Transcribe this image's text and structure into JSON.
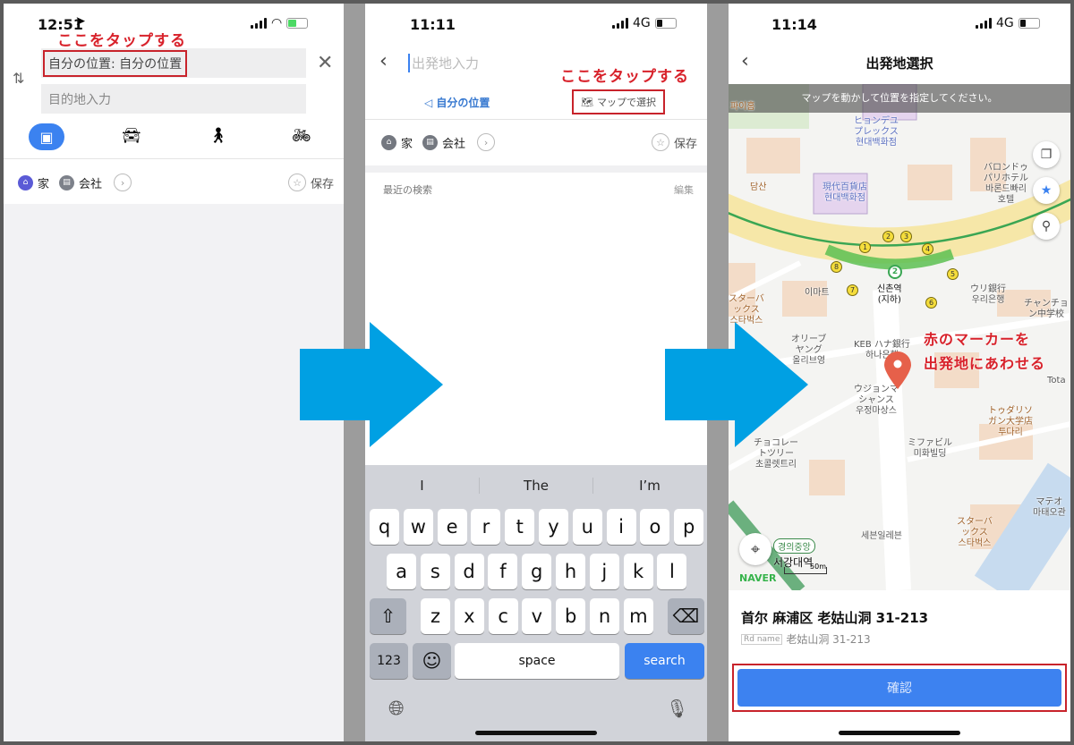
{
  "colors": {
    "accent": "#3b82f0",
    "annotation": "#d8222b",
    "arrow": "#00a0e3"
  },
  "panel1": {
    "status": {
      "time": "12:51",
      "location_icon": "location-arrow-icon",
      "signal": "signal-icon",
      "wifi": "wifi-icon",
      "battery": "battery-charging-icon"
    },
    "annotation": "ここをタップする",
    "origin_value": "自分の位置: 自分の位置",
    "destination_placeholder": "目的地入力",
    "modes": [
      {
        "icon": "bus-icon",
        "selected": true
      },
      {
        "icon": "car-icon"
      },
      {
        "icon": "walk-icon"
      },
      {
        "icon": "bicycle-icon"
      }
    ],
    "favorites": {
      "home": "家",
      "work": "会社",
      "save": "保存"
    }
  },
  "panel2": {
    "status": {
      "time": "11:11",
      "network": "4G"
    },
    "origin_placeholder": "出発地入力",
    "annotation": "ここをタップする",
    "my_location": "自分の位置",
    "map_select": "マップで選択",
    "favorites": {
      "home": "家",
      "work": "会社",
      "save": "保存"
    },
    "recent_title": "最近の検索",
    "edit": "編集",
    "keyboard": {
      "suggestions": [
        "I",
        "The",
        "I’m"
      ],
      "row1": [
        "q",
        "w",
        "e",
        "r",
        "t",
        "y",
        "u",
        "i",
        "o",
        "p"
      ],
      "row2": [
        "a",
        "s",
        "d",
        "f",
        "g",
        "h",
        "j",
        "k",
        "l"
      ],
      "row3": [
        "z",
        "x",
        "c",
        "v",
        "b",
        "n",
        "m"
      ],
      "numbers": "123",
      "space": "space",
      "search": "search"
    }
  },
  "panel3": {
    "status": {
      "time": "11:14",
      "network": "4G"
    },
    "title": "出発地選択",
    "banner": "マップを動かして位置を指定してください。",
    "annotation": [
      "赤のマーカーを",
      "出発地にあわせる"
    ],
    "map_labels": [
      "파이홈",
      "ヒョンデユ\nプレックス\n현대백화점",
      "バロンドゥ\nパリホテル\n바론드빠리\n호텔",
      "담산",
      "現代百貨店\n현대백화점",
      "신촌역\n(지하)",
      "이마트",
      "ウリ銀行\n우리은행",
      "スターバ\nックス\n스타벅스",
      "チャンチョ\nン中学校",
      "オリーブ\nヤング\n올리브영",
      "KEB ハナ銀行\n하나은행",
      "ウジョンマ\nシャンス\n우정마상스",
      "トゥダリソ\nガン大学店\n투다리",
      "チョコレー\nトツリー\n초콜렛트리",
      "ミファビル\n미화빌딩",
      "세븐일레븐",
      "スターバ\nックス\n스타벅스",
      "マテオ\n마태오관",
      "Tota"
    ],
    "station_line": "경의중앙",
    "station_name": "서강대역",
    "exits": [
      "1",
      "2",
      "3",
      "4",
      "5",
      "6",
      "7",
      "8"
    ],
    "line_number": "2",
    "scale": "50m",
    "logo": "NAVER",
    "address": "首尔 麻浦区 老姑山洞 31-213",
    "rd_badge": "Rd name",
    "rd_address": "老姑山洞 31-213",
    "confirm": "確認"
  }
}
